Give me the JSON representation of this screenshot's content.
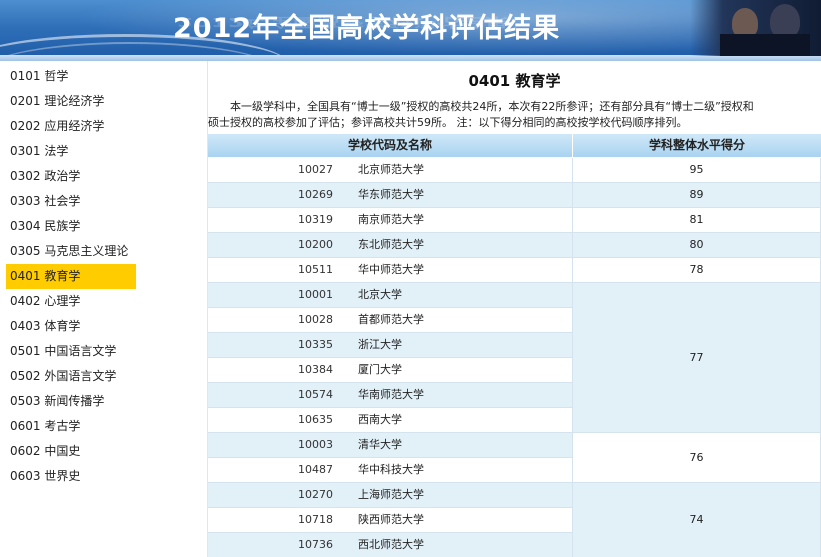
{
  "banner": {
    "title": "2012年全国高校学科评估结果"
  },
  "sidebar": {
    "items": [
      {
        "label": "0101 哲学"
      },
      {
        "label": "0201 理论经济学"
      },
      {
        "label": "0202 应用经济学"
      },
      {
        "label": "0301 法学"
      },
      {
        "label": "0302 政治学"
      },
      {
        "label": "0303 社会学"
      },
      {
        "label": "0304 民族学"
      },
      {
        "label": "0305 马克思主义理论"
      },
      {
        "label": "0401 教育学",
        "active": true
      },
      {
        "label": "0402 心理学"
      },
      {
        "label": "0403 体育学"
      },
      {
        "label": "0501 中国语言文学"
      },
      {
        "label": "0502 外国语言文学"
      },
      {
        "label": "0503 新闻传播学"
      },
      {
        "label": "0601 考古学"
      },
      {
        "label": "0602 中国史"
      },
      {
        "label": "0603 世界史"
      }
    ]
  },
  "main": {
    "title": "0401 教育学",
    "intro_line1": "本一级学科中，全国具有“博士一级”授权的高校共24所，本次有22所参评；还有部分具有“博士二级”授权和",
    "intro_line2": "硕士授权的高校参加了评估；参评高校共计59所。 注：以下得分相同的高校按学校代码顺序排列。",
    "table": {
      "headers": {
        "name": "学校代码及名称",
        "score": "学科整体水平得分"
      },
      "rows": [
        {
          "code": "10027",
          "name": "北京师范大学"
        },
        {
          "code": "10269",
          "name": "华东师范大学"
        },
        {
          "code": "10319",
          "name": "南京师范大学"
        },
        {
          "code": "10200",
          "name": "东北师范大学"
        },
        {
          "code": "10511",
          "name": "华中师范大学"
        },
        {
          "code": "10001",
          "name": "北京大学"
        },
        {
          "code": "10028",
          "name": "首都师范大学"
        },
        {
          "code": "10335",
          "name": "浙江大学"
        },
        {
          "code": "10384",
          "name": "厦门大学"
        },
        {
          "code": "10574",
          "name": "华南师范大学"
        },
        {
          "code": "10635",
          "name": "西南大学"
        },
        {
          "code": "10003",
          "name": "清华大学"
        },
        {
          "code": "10487",
          "name": "华中科技大学"
        },
        {
          "code": "10270",
          "name": "上海师范大学"
        },
        {
          "code": "10718",
          "name": "陕西师范大学"
        },
        {
          "code": "10736",
          "name": "西北师范大学"
        }
      ],
      "score_groups": [
        {
          "score": "95",
          "count": 1
        },
        {
          "score": "89",
          "count": 1
        },
        {
          "score": "81",
          "count": 1
        },
        {
          "score": "80",
          "count": 1
        },
        {
          "score": "78",
          "count": 1
        },
        {
          "score": "77",
          "count": 6
        },
        {
          "score": "76",
          "count": 2
        },
        {
          "score": "74",
          "count": 3
        }
      ]
    }
  },
  "colors": {
    "active_item": "#ffcc00",
    "row_alt": "#e2f0f8",
    "header_bg": "#a9d3f0",
    "banner_bg": "#2f6fb8"
  }
}
